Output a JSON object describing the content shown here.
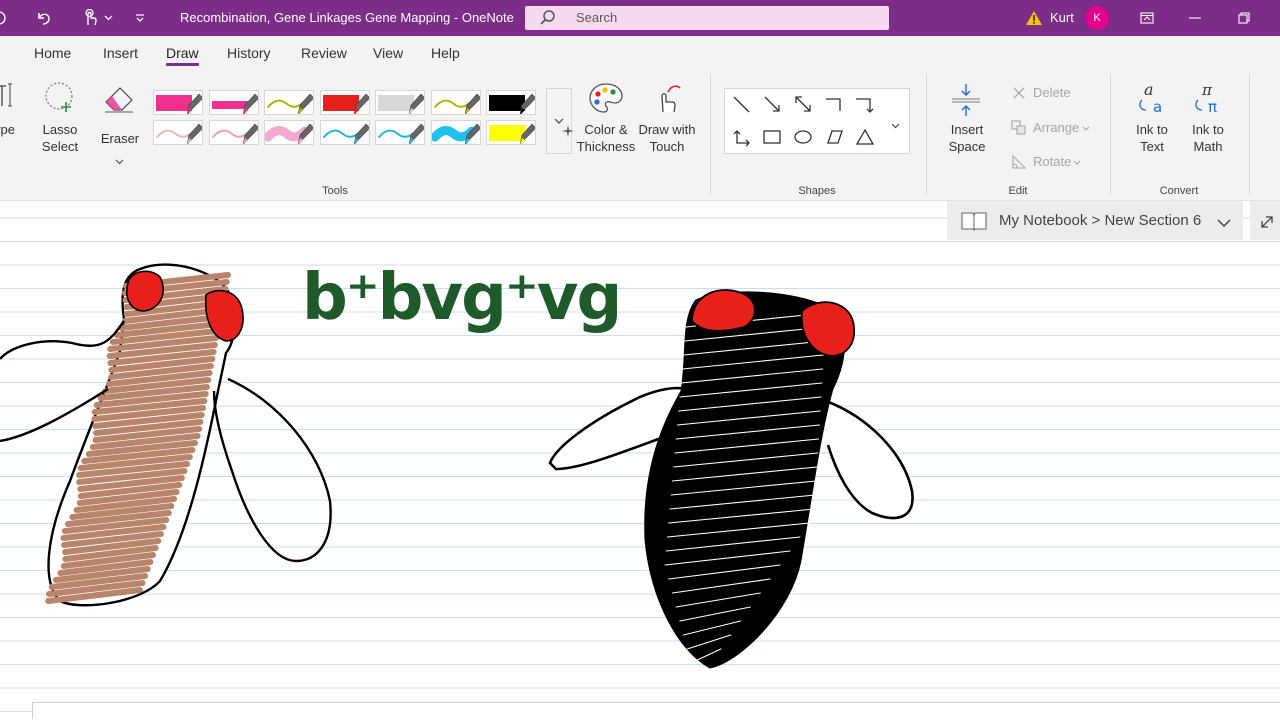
{
  "titlebar": {
    "title": "Recombination, Gene Linkages Gene Mapping  -  OneNote",
    "search_placeholder": "Search",
    "user_name": "Kurt",
    "avatar_initial": "K",
    "accent_color": "#7b2d87"
  },
  "tabs": [
    {
      "label": "Home"
    },
    {
      "label": "Insert"
    },
    {
      "label": "Draw"
    },
    {
      "label": "History"
    },
    {
      "label": "Review"
    },
    {
      "label": "View"
    },
    {
      "label": "Help"
    }
  ],
  "ribbon": {
    "type_label": "ype",
    "lasso_label_1": "Lasso",
    "lasso_label_2": "Select",
    "eraser_label": "Eraser",
    "color_label_1": "Color &",
    "color_label_2": "Thickness",
    "touch_label_1": "Draw with",
    "touch_label_2": "Touch",
    "tools_group": "Tools",
    "shapes_group": "Shapes",
    "insert_space_1": "Insert",
    "insert_space_2": "Space",
    "delete_label": "Delete",
    "arrange_label": "Arrange",
    "rotate_label": "Rotate",
    "edit_group": "Edit",
    "ink_text_1": "Ink to",
    "ink_text_2": "Text",
    "ink_math_1": "Ink to",
    "ink_math_2": "Math",
    "convert_group": "Convert"
  },
  "pens": [
    {
      "color": "#f0308f",
      "style": "marker"
    },
    {
      "color": "#f0308f",
      "style": "thin-bar"
    },
    {
      "color": "#b6b400",
      "style": "squiggle"
    },
    {
      "color": "#e8201c",
      "style": "marker"
    },
    {
      "color": "#d8d8d8",
      "style": "marker"
    },
    {
      "color": "#b6b400",
      "style": "squiggle"
    },
    {
      "color": "#000000",
      "style": "marker"
    },
    {
      "color": "#e8b4b4",
      "style": "squiggle"
    },
    {
      "color": "#f0a0b0",
      "style": "squiggle"
    },
    {
      "color": "#f7a8d0",
      "style": "thick-squiggle"
    },
    {
      "color": "#20b8e0",
      "style": "squiggle"
    },
    {
      "color": "#20b8e0",
      "style": "squiggle"
    },
    {
      "color": "#20c0f0",
      "style": "thick-squiggle"
    },
    {
      "color": "#ffff00",
      "style": "marker"
    }
  ],
  "breadcrumb": {
    "text": "My Notebook > New Section 6"
  },
  "page": {
    "handwriting": "b⁺bvg⁺vg",
    "ink_green": "#1f5a2a",
    "eye_red": "#e8201c",
    "body_brown": "#b9856a"
  }
}
